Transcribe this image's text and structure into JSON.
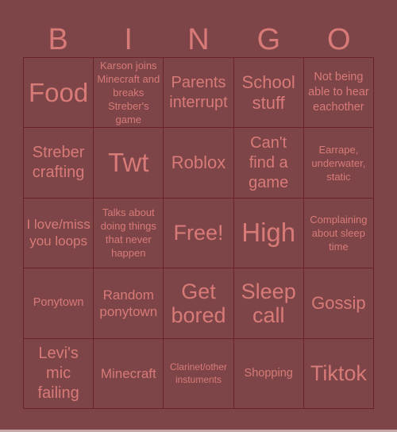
{
  "header": {
    "letters": [
      "B",
      "I",
      "N",
      "G",
      "O"
    ]
  },
  "colors": {
    "background": "#7d4547",
    "text": "#d87a78",
    "grid_line": "#6a2426"
  },
  "board": {
    "rows": [
      [
        "Food",
        "Karson joins Minecraft and breaks Streber's game",
        "Parents interrupt",
        "School stuff",
        "Not being able to hear eachother"
      ],
      [
        "Streber crafting",
        "Twt",
        "Roblox",
        "Can't find a game",
        "Earrape, underwater, static"
      ],
      [
        "I love/miss you loops",
        "Talks about doing things that never happen",
        "Free!",
        "High",
        "Complaining about sleep time"
      ],
      [
        "Ponytown",
        "Random ponytown",
        "Get bored",
        "Sleep call",
        "Gossip"
      ],
      [
        "Levi's mic failing",
        "Minecraft",
        "Clarinet/other instuments",
        "Shopping",
        "Tiktok"
      ]
    ]
  }
}
